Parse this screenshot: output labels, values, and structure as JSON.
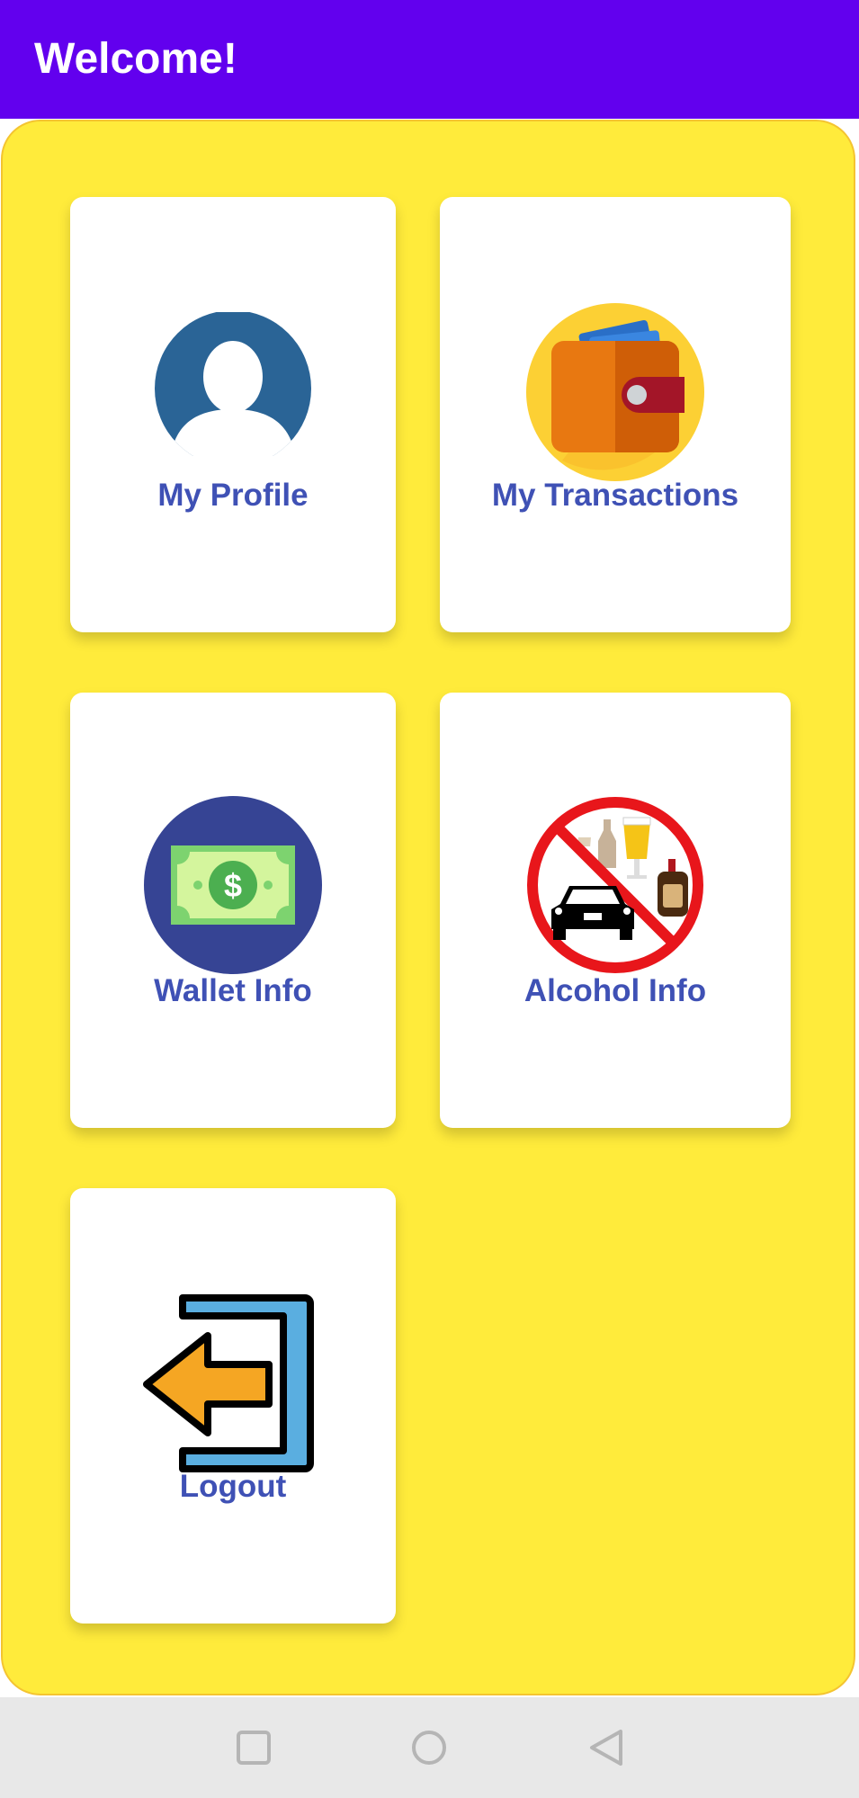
{
  "app_bar": {
    "title": "Welcome!",
    "color": "#6200ee"
  },
  "main": {
    "background_color": "#ffeb3b",
    "cards": [
      {
        "label": "My Profile",
        "icon": "profile-icon"
      },
      {
        "label": "My Transactions",
        "icon": "wallet-icon"
      },
      {
        "label": "Wallet Info",
        "icon": "money-icon"
      },
      {
        "label": "Alcohol Info",
        "icon": "no-drink-drive-icon"
      },
      {
        "label": "Logout",
        "icon": "logout-icon"
      }
    ]
  },
  "nav_bar": {
    "buttons": [
      "recents-icon",
      "home-icon",
      "back-icon"
    ]
  },
  "colors": {
    "label": "#3f51b5",
    "card": "#ffffff"
  }
}
